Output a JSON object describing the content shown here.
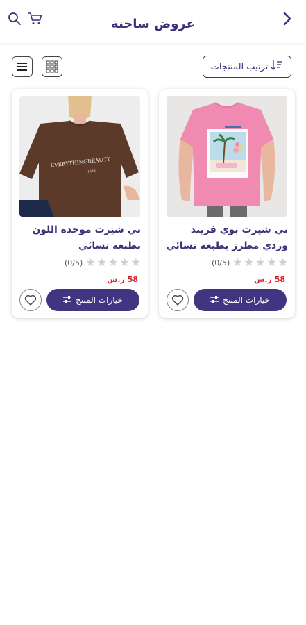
{
  "header": {
    "title": "عروض ساخنة",
    "icons": {
      "back": "chevron-right-icon",
      "cart": "cart-icon",
      "search": "search-icon"
    }
  },
  "toolbar": {
    "sort_label": "ترتيب المنتجات",
    "icons": {
      "list_view": "list-view-icon",
      "grid_view": "grid-view-icon",
      "sort": "sort-icon"
    }
  },
  "products": [
    {
      "name": "تي شيرت بوي فريند وردي مطرز بطبعة نسائي",
      "rating_text": "(0/5)",
      "stars_filled": 0,
      "stars_total": 5,
      "price": "58 ر.س",
      "options_label": "خيارات المنتج",
      "image": "pink-tshirt-photo"
    },
    {
      "name": "تي شيرت موحدة اللون بطبعة نسائي",
      "rating_text": "(0/5)",
      "stars_filled": 0,
      "stars_total": 5,
      "price": "58 ر.س",
      "options_label": "خيارات المنتج",
      "image": "brown-tshirt-photo"
    }
  ],
  "colors": {
    "primary": "#3f3580",
    "price": "#d8232a",
    "star_empty": "#cfcfcf"
  }
}
